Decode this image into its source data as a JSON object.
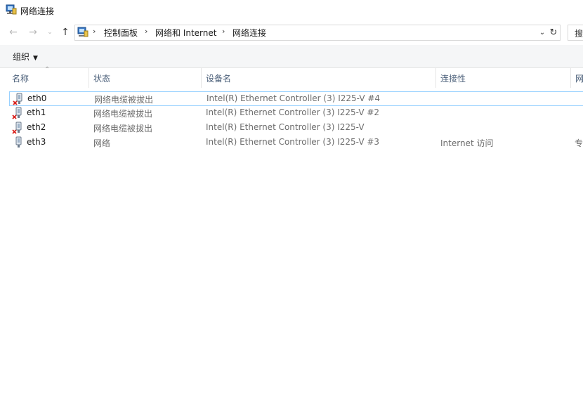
{
  "window": {
    "title": "网络连接"
  },
  "nav": {
    "breadcrumbs": [
      "控制面板",
      "网络和 Internet",
      "网络连接"
    ],
    "search_label": "搜"
  },
  "toolbar": {
    "organize_label": "组织"
  },
  "columns": {
    "name": "名称",
    "status": "状态",
    "device": "设备名",
    "connectivity": "连接性",
    "network": "网"
  },
  "rows": [
    {
      "name": "eth0",
      "status": "网络电缆被拔出",
      "device": "Intel(R) Ethernet Controller (3) I225-V #4",
      "connectivity": "",
      "network": "",
      "disconnected": true
    },
    {
      "name": "eth1",
      "status": "网络电缆被拔出",
      "device": "Intel(R) Ethernet Controller (3) I225-V #2",
      "connectivity": "",
      "network": "",
      "disconnected": true
    },
    {
      "name": "eth2",
      "status": "网络电缆被拔出",
      "device": "Intel(R) Ethernet Controller (3) I225-V",
      "connectivity": "",
      "network": "",
      "disconnected": true
    },
    {
      "name": "eth3",
      "status": "网络",
      "device": "Intel(R) Ethernet Controller (3) I225-V #3",
      "connectivity": "Internet 访问",
      "network": "专",
      "disconnected": false
    }
  ],
  "icons": {
    "title": "network-connections-icon",
    "address": "control-panel-icon",
    "adapter": "network-adapter-icon",
    "disconnected_badge": "red-x-icon"
  }
}
